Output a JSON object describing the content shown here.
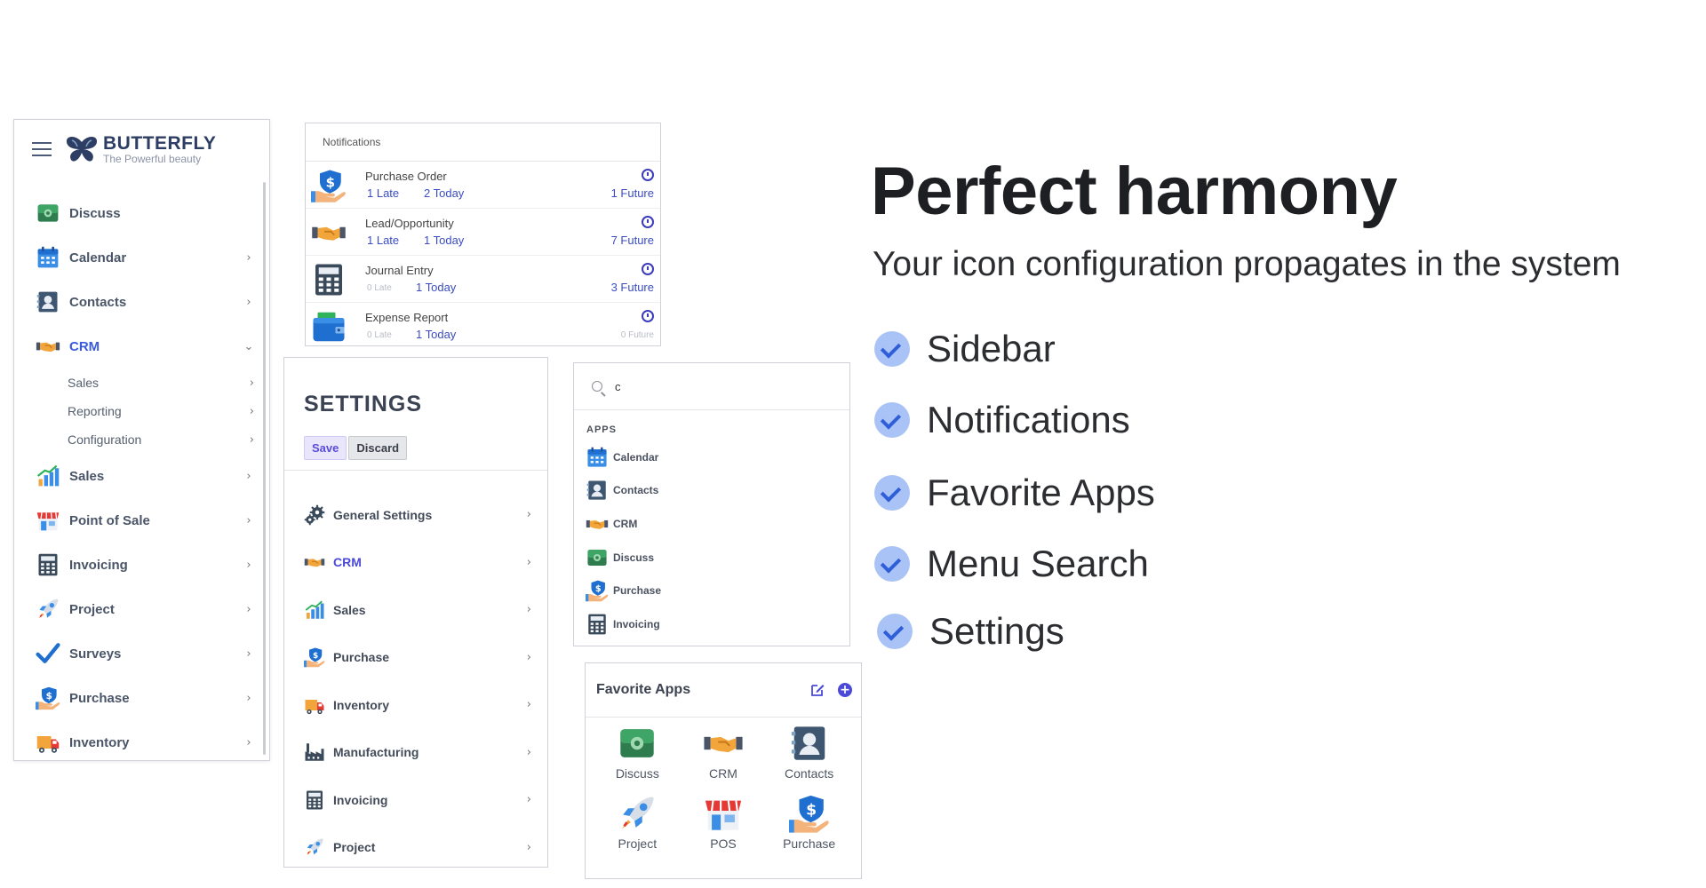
{
  "sidebar": {
    "logo_title": "BUTTERFLY",
    "logo_subtitle": "The Powerful beauty",
    "items": [
      {
        "label": "Discuss"
      },
      {
        "label": "Calendar"
      },
      {
        "label": "Contacts"
      },
      {
        "label": "CRM"
      },
      {
        "label": "Sales"
      },
      {
        "label": "Point of Sale"
      },
      {
        "label": "Invoicing"
      },
      {
        "label": "Project"
      },
      {
        "label": "Surveys"
      },
      {
        "label": "Purchase"
      },
      {
        "label": "Inventory"
      }
    ],
    "crm_subitems": [
      {
        "label": "Sales"
      },
      {
        "label": "Reporting"
      },
      {
        "label": "Configuration"
      }
    ]
  },
  "notifications": {
    "title": "Notifications",
    "rows": [
      {
        "name": "Purchase Order",
        "late": "1 Late",
        "today": "2 Today",
        "future": "1 Future",
        "late_dim": false,
        "future_dim": false
      },
      {
        "name": "Lead/Opportunity",
        "late": "1 Late",
        "today": "1 Today",
        "future": "7 Future",
        "late_dim": false,
        "future_dim": false
      },
      {
        "name": "Journal Entry",
        "late": "0 Late",
        "today": "1 Today",
        "future": "3 Future",
        "late_dim": true,
        "future_dim": false
      },
      {
        "name": "Expense Report",
        "late": "0 Late",
        "today": "1 Today",
        "future": "0 Future",
        "late_dim": true,
        "future_dim": true
      }
    ]
  },
  "settings": {
    "title": "SETTINGS",
    "save_label": "Save",
    "discard_label": "Discard",
    "items": [
      {
        "label": "General Settings"
      },
      {
        "label": "CRM"
      },
      {
        "label": "Sales"
      },
      {
        "label": "Purchase"
      },
      {
        "label": "Inventory"
      },
      {
        "label": "Manufacturing"
      },
      {
        "label": "Invoicing"
      },
      {
        "label": "Project"
      }
    ]
  },
  "menu_search": {
    "query": "c",
    "section_label": "APPS",
    "results": [
      {
        "label": "Calendar"
      },
      {
        "label": "Contacts"
      },
      {
        "label": "CRM"
      },
      {
        "label": "Discuss"
      },
      {
        "label": "Purchase"
      },
      {
        "label": "Invoicing"
      }
    ]
  },
  "favorite_apps": {
    "title": "Favorite Apps",
    "add_symbol": "+",
    "apps": [
      {
        "label": "Discuss"
      },
      {
        "label": "CRM"
      },
      {
        "label": "Contacts"
      },
      {
        "label": "Project"
      },
      {
        "label": "POS"
      },
      {
        "label": "Purchase"
      }
    ]
  },
  "hero": {
    "title": "Perfect harmony",
    "subtitle": "Your icon configuration propagates in the system",
    "features": [
      {
        "label": "Sidebar"
      },
      {
        "label": "Notifications"
      },
      {
        "label": "Favorite Apps"
      },
      {
        "label": "Menu Search"
      },
      {
        "label": "Settings"
      }
    ]
  },
  "chevrons": {
    "right": "›",
    "down": "⌄"
  },
  "colors": {
    "accent": "#3b5bdb",
    "check_bg": "#aac3f6",
    "check_mark": "#2f5fd8",
    "link": "#3b4cc0"
  },
  "icons": [
    "discuss-icon",
    "calendar-icon",
    "contacts-icon",
    "crm-handshake-icon",
    "sales-chart-icon",
    "point-of-sale-icon",
    "invoicing-calculator-icon",
    "project-rocket-icon",
    "surveys-check-icon",
    "purchase-hand-dollar-icon",
    "inventory-truck-icon",
    "manufacturing-factory-icon",
    "general-settings-gears-icon",
    "expense-wallet-icon"
  ]
}
